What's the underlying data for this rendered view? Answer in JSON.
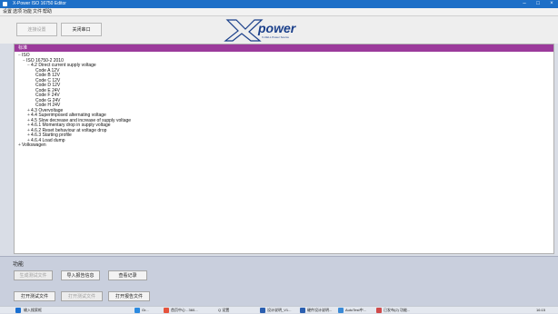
{
  "window": {
    "title": "X-Power ISO 16750 Editor"
  },
  "menu": [
    "设置",
    "选项",
    "功能",
    "文件",
    "帮助"
  ],
  "toolbar": {
    "btn1": "连接设置",
    "btn2": "关闭串口"
  },
  "logo": {
    "brand": "power",
    "sub": "X-CELL Power Source"
  },
  "tree": {
    "header": "标准",
    "nodes": [
      {
        "label": "ISO",
        "level": 0,
        "exp": "−"
      },
      {
        "label": "ISO 16750-2 2010",
        "level": 1,
        "exp": "−"
      },
      {
        "label": "4.2 Direct current supply voltage",
        "level": 2,
        "exp": "−"
      },
      {
        "label": "Code A 12V",
        "level": 3,
        "exp": ""
      },
      {
        "label": "Code B 12V",
        "level": 3,
        "exp": ""
      },
      {
        "label": "Code C 12V",
        "level": 3,
        "exp": ""
      },
      {
        "label": "Code D 12V",
        "level": 3,
        "exp": ""
      },
      {
        "label": "Code E 24V",
        "level": 3,
        "exp": ""
      },
      {
        "label": "Code F 24V",
        "level": 3,
        "exp": ""
      },
      {
        "label": "Code G 24V",
        "level": 3,
        "exp": ""
      },
      {
        "label": "Code H 24V",
        "level": 3,
        "exp": ""
      },
      {
        "label": "4.3 Overvoltage",
        "level": 2,
        "exp": "+"
      },
      {
        "label": "4.4 Superimposed alternating voltage",
        "level": 2,
        "exp": "+"
      },
      {
        "label": "4.5 Slow decrease and increase of supply voltage",
        "level": 2,
        "exp": "+"
      },
      {
        "label": "4.6.1 Momentary drop in supply voltage",
        "level": 2,
        "exp": "+"
      },
      {
        "label": "4.6.2 Reset behaviour at voltage drop",
        "level": 2,
        "exp": "+"
      },
      {
        "label": "4.6.3 Starting profile",
        "level": 2,
        "exp": "+"
      },
      {
        "label": "4.6.4 Load dump",
        "level": 2,
        "exp": "+"
      },
      {
        "label": "Volkswagen",
        "level": 0,
        "exp": "+"
      }
    ]
  },
  "functions": {
    "title": "功能",
    "row1": [
      "生成测试文件",
      "导入报告信息",
      "查看记录"
    ],
    "row2": [
      "打开测试文件",
      "打开测试文件",
      "打开报告文件"
    ]
  },
  "taskbar": {
    "start": "输入搜索框",
    "items": [
      "Gr...",
      "首页中心 - 360...",
      "Q 设置",
      "设计说明_V1...",
      "硬件设计说明...",
      "AutoTest中...",
      "已发布(2) 功能..."
    ],
    "time": "16:15"
  }
}
